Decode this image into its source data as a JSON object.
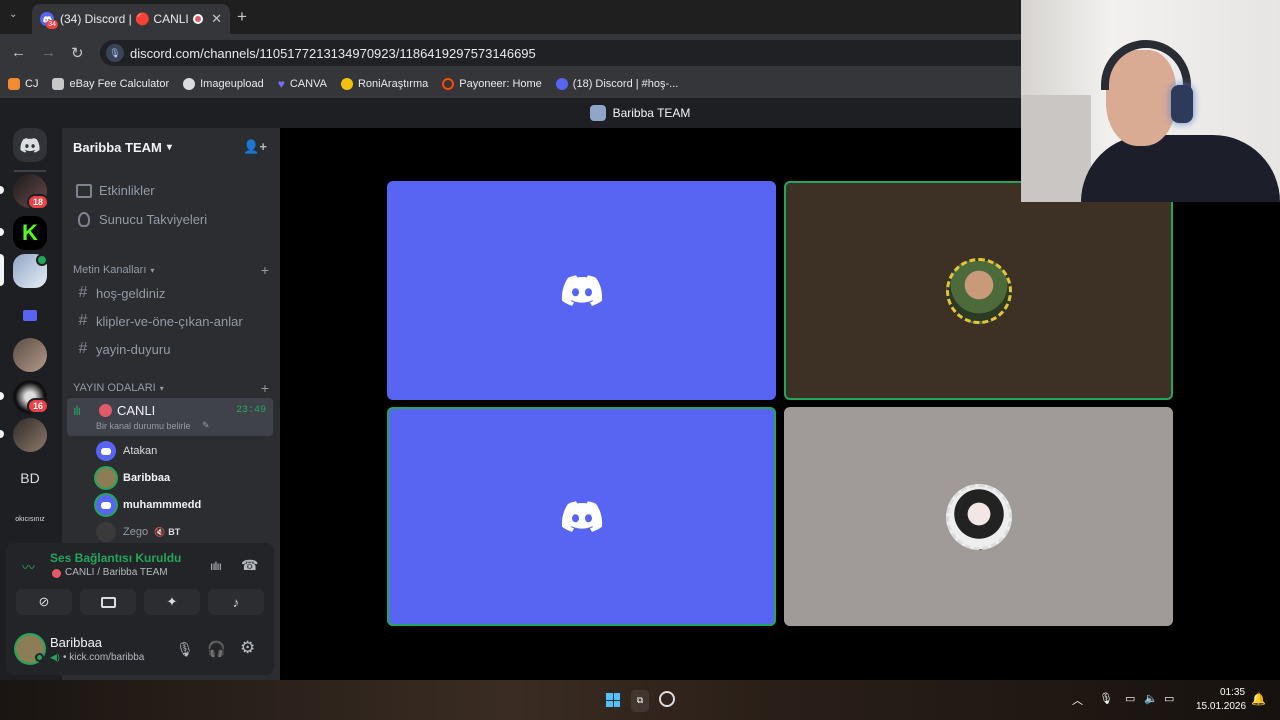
{
  "browser": {
    "tab_title": "(34) Discord | 🔴 CANLI | B",
    "tab_badge": "34",
    "url": "discord.com/channels/1105177213134970923/1186419297573146695",
    "bookmarks": [
      {
        "label": "CJ",
        "icon": "cj-icon",
        "color": "#f28b30"
      },
      {
        "label": "eBay Fee Calculator",
        "icon": "calculator-icon",
        "color": "#c8c8c8"
      },
      {
        "label": "Imageupload",
        "icon": "cloud-icon",
        "color": "#dadce0"
      },
      {
        "label": "CANVA",
        "icon": "canva-heart-icon",
        "color": "#7b6cf6"
      },
      {
        "label": "RoniAraştırma",
        "icon": "pacman-icon",
        "color": "#f4c20d"
      },
      {
        "label": "Payoneer: Home",
        "icon": "payoneer-icon",
        "color": "#ff4800"
      },
      {
        "label": "(18) Discord | #hoş-...",
        "icon": "discord-icon",
        "color": "#5865f2"
      }
    ]
  },
  "discord": {
    "window_title": "Baribba TEAM",
    "server_name": "Baribba TEAM",
    "guild_badges": [
      "18",
      "16"
    ],
    "guild_text_icons": [
      "BD",
      "okıcısınız"
    ],
    "top_items": [
      "Etkinlikler",
      "Sunucu Takviyeleri"
    ],
    "text_category": "Metin Kanalları",
    "text_channels": [
      "hoş-geldiniz",
      "klipler-ve-öne-çıkan-anlar",
      "yayin-duyuru"
    ],
    "voice_category": "YAYIN ODALARI",
    "voice_channel": {
      "name": "CANLI",
      "timer": "23:49",
      "status": "Bir kanal durumu belirle"
    },
    "members": [
      {
        "name": "Atakan",
        "muted": false
      },
      {
        "name": "Baribbaa",
        "muted": false
      },
      {
        "name": "muhammmedd",
        "muted": false
      },
      {
        "name": "Zego",
        "tag": "BT",
        "muted": true
      }
    ],
    "voice_panel": {
      "status": "Ses Bağlantısı Kuruldu",
      "location": "CANLI / Baribba TEAM"
    },
    "user": {
      "name": "Baribbaa",
      "status": "kick.com/baribba"
    }
  },
  "tiles": [
    {
      "kind": "discord-logo",
      "bg": "#5865f2",
      "speaking": false
    },
    {
      "kind": "avatar",
      "bg": "#3c3124",
      "speaking": true
    },
    {
      "kind": "discord-logo",
      "bg": "#5865f2",
      "speaking": true
    },
    {
      "kind": "avatar",
      "bg": "#a09a98",
      "speaking": false
    }
  ],
  "taskbar": {
    "time": "01:35",
    "date": "15.01.2026"
  },
  "colors": {
    "blurple": "#5865f2",
    "green": "#23a55a",
    "red": "#ed4245"
  }
}
